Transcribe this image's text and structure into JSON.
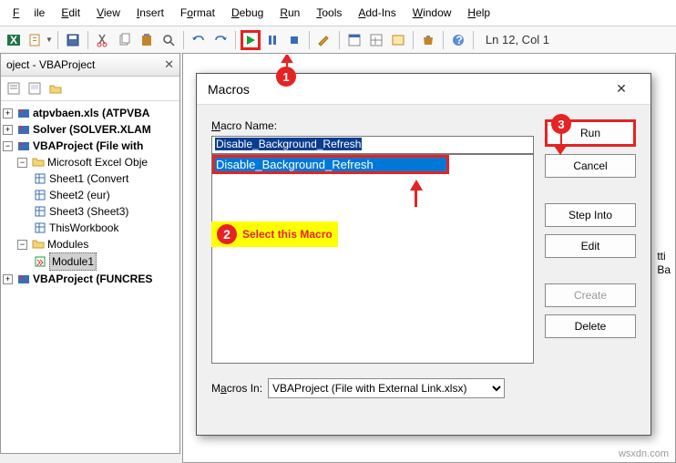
{
  "menu": {
    "file": "File",
    "edit": "Edit",
    "view": "View",
    "insert": "Insert",
    "format": "Format",
    "debug": "Debug",
    "run": "Run",
    "tools": "Tools",
    "addins": "Add-Ins",
    "window": "Window",
    "help": "Help"
  },
  "toolbar": {
    "position": "Ln 12, Col 1"
  },
  "project_pane": {
    "title": "oject - VBAProject",
    "nodes": {
      "atp": "atpvbaen.xls (ATPVBA",
      "solver": "Solver (SOLVER.XLAM",
      "vbap": "VBAProject (File with",
      "msobj": "Microsoft Excel Obje",
      "sheet1": "Sheet1 (Convert",
      "sheet2": "Sheet2 (eur)",
      "sheet3": "Sheet3 (Sheet3)",
      "twb": "ThisWorkbook",
      "modules": "Modules",
      "module1": "Module1",
      "funcres": "VBAProject (FUNCRES"
    }
  },
  "code_pane": {
    "line1": "tti",
    "line2": "Ba"
  },
  "dialog": {
    "title": "Macros",
    "name_label": "Macro Name:",
    "macro_name": "Disable_Background_Refresh",
    "list_item": "Disable_Background_Refresh",
    "macros_in_label": "Macros In:",
    "macros_in_value": "VBAProject (File with External Link.xlsx)",
    "buttons": {
      "run": "Run",
      "cancel": "Cancel",
      "step": "Step Into",
      "edit": "Edit",
      "create": "Create",
      "delete": "Delete"
    }
  },
  "annotations": {
    "c1": "1",
    "c2": "2",
    "c3": "3",
    "select_text": "Select this Macro"
  },
  "watermark": "wsxdn.com"
}
